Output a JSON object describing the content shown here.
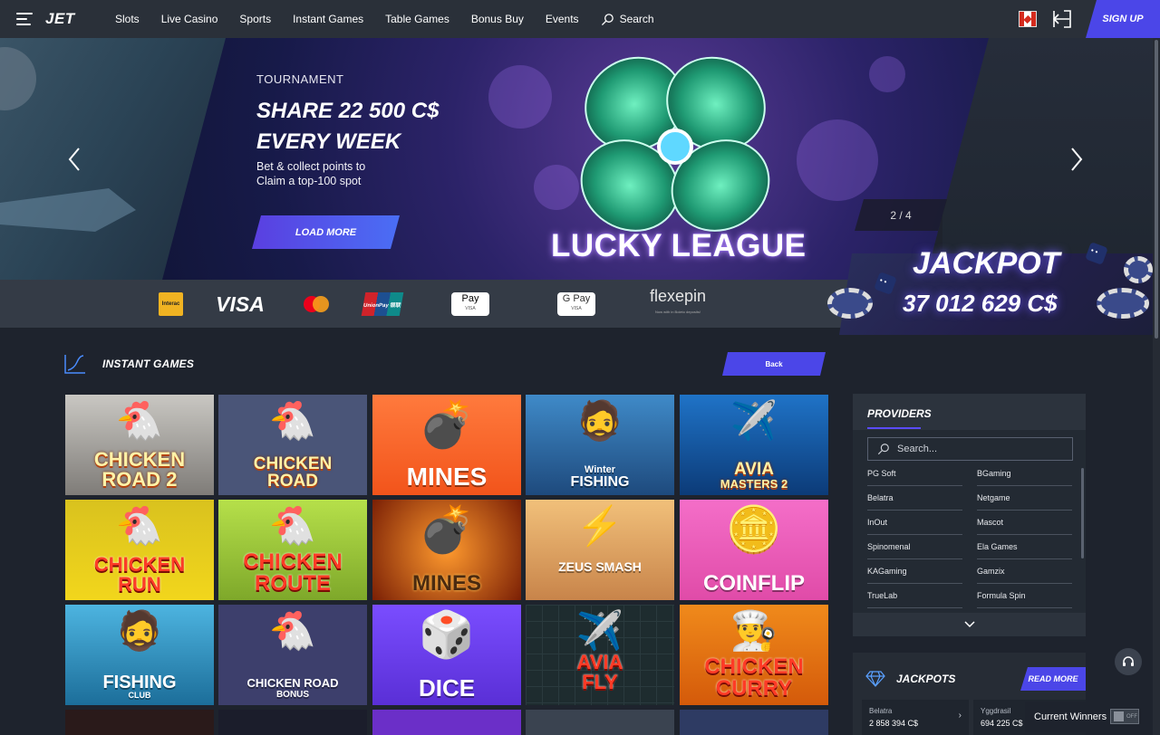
{
  "header": {
    "logo": "JET",
    "nav": [
      "Slots",
      "Live Casino",
      "Sports",
      "Instant Games",
      "Table Games",
      "Bonus Buy",
      "Events"
    ],
    "search_label": "Search",
    "signup_label": "SIGN UP"
  },
  "hero": {
    "label": "TOURNAMENT",
    "title_line1": "SHARE 22 500 C$",
    "title_line2": "EVERY WEEK",
    "desc_line1": "Bet & collect points to",
    "desc_line2": "Claim a top-100 spot",
    "button": "LOAD MORE",
    "image_text": "LUCKY LEAGUE",
    "counter": "2 / 4"
  },
  "payments": {
    "interac": "Interac",
    "visa": "VISA",
    "unionpay": "UnionPay 银联",
    "applepay": "Pay",
    "gpay": "G Pay",
    "mini_visa": "VISA",
    "flexepin": "flexepin",
    "flexepin_sub": "Now with in Boleto deposits!"
  },
  "jackpot": {
    "title": "JACKPOT",
    "value": "37 012 629 C$"
  },
  "section": {
    "title": "INSTANT GAMES",
    "back": "Back"
  },
  "games": [
    {
      "l1": "CHICKEN",
      "l2": "ROAD 2"
    },
    {
      "l1": "CHICKEN",
      "l2": "ROAD"
    },
    {
      "l1": "MINES",
      "l2": ""
    },
    {
      "l1": "Winter",
      "l2": "FISHING"
    },
    {
      "l1": "AVIA",
      "l2": "MASTERS 2"
    },
    {
      "l1": "CHICKEN",
      "l2": "RUN"
    },
    {
      "l1": "CHICKEN",
      "l2": "ROUTE"
    },
    {
      "l1": "MINES",
      "l2": ""
    },
    {
      "l1": "ZEUS",
      "l2": "SMASH"
    },
    {
      "l1": "COINFLIP",
      "l2": ""
    },
    {
      "l1": "FISHING",
      "l2": "CLUB"
    },
    {
      "l1": "CHICKEN ROAD",
      "l2": "BONUS"
    },
    {
      "l1": "DICE",
      "l2": ""
    },
    {
      "l1": "AVIA",
      "l2": "FLY"
    },
    {
      "l1": "CHICKEN",
      "l2": "CURRY"
    }
  ],
  "providers": {
    "title": "PROVIDERS",
    "search_placeholder": "Search...",
    "items": [
      "PG Soft",
      "BGaming",
      "Belatra",
      "Netgame",
      "InOut",
      "Mascot",
      "Spinomenal",
      "Ela Games",
      "KAGaming",
      "Gamzix",
      "TrueLab",
      "Formula Spin"
    ]
  },
  "jackpots": {
    "title": "JACKPOTS",
    "more": "READ MORE",
    "cards": [
      {
        "name": "Belatra",
        "value": "2 858 394 C$"
      },
      {
        "name": "Yggdrasil",
        "value": "694 225 C$"
      }
    ]
  },
  "winners": {
    "label": "Current Winners",
    "toggle": "OFF"
  }
}
